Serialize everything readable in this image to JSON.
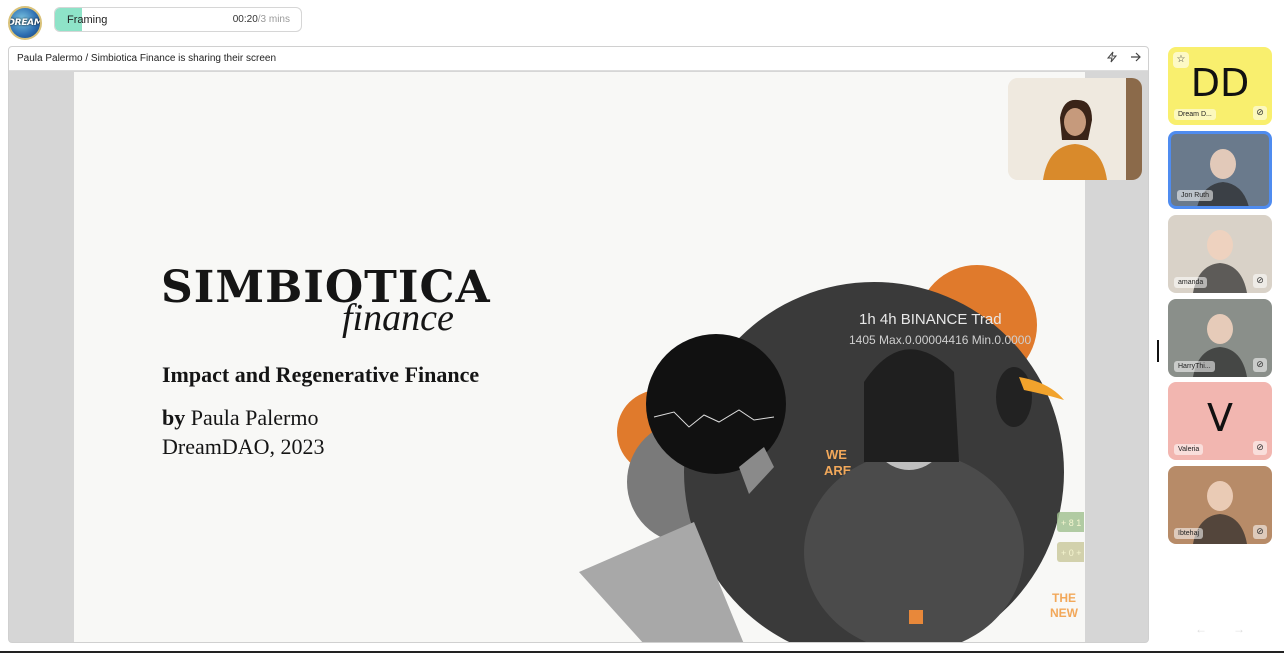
{
  "app": {
    "logo_text": "DREAM"
  },
  "agenda": {
    "item_name": "Framing",
    "elapsed": "00:20",
    "total": "/3 mins",
    "progress": 0.11,
    "accent_color": "#8ee3c8"
  },
  "share": {
    "label": "Paula Palermo / Simbiotica Finance is sharing their screen",
    "icons": [
      "lightning-icon",
      "arrow-right-icon"
    ]
  },
  "slide": {
    "title": "SIMBIOTICA",
    "subtitle": "finance",
    "line1": "Impact and Regenerative Finance",
    "line2_prefix": "by",
    "line2_name": "Paula Palermo",
    "line3": "DreamDAO, 2023",
    "collage_text": {
      "ticker": "1h   4h   BINANCE   Trad",
      "ticker2": "1405  Max.0.00004416  Min.0.0000",
      "we_are": "WE\nARE",
      "the_new": "THE\nNEW",
      "price1": "+ 8 1 9 1",
      "price2": "+ 0 + 4 6"
    }
  },
  "participants": [
    {
      "name": "Dream D...",
      "initials": "DD",
      "bg": "#f9ef6e",
      "muted": true,
      "pinned": true
    },
    {
      "name": "Jon Ruth",
      "initials": "",
      "bg": "#6a7a8c",
      "muted": false,
      "active": true
    },
    {
      "name": "amanda",
      "initials": "",
      "bg": "#d9d2c8",
      "muted": true
    },
    {
      "name": "HarryThi...",
      "initials": "",
      "bg": "#8a8f8a",
      "muted": true
    },
    {
      "name": "Valeria",
      "initials": "V",
      "bg": "#f2b6b0",
      "muted": true
    },
    {
      "name": "Ibtehaj",
      "initials": "",
      "bg": "#b78b68",
      "muted": true
    }
  ]
}
